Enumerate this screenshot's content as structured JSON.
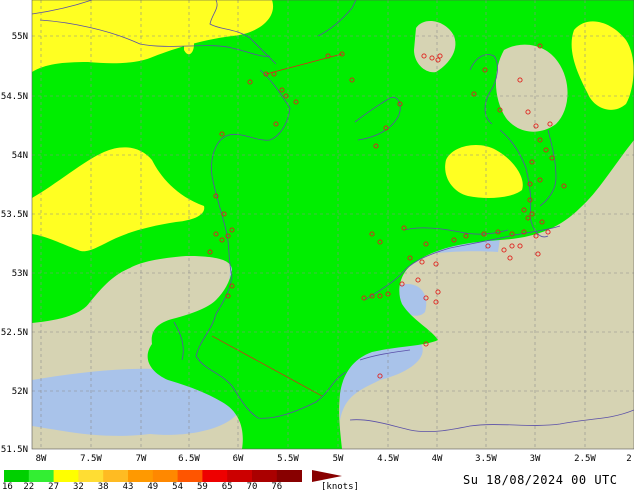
{
  "map": {
    "lat_labels": [
      "55N",
      "54.5N",
      "54N",
      "53.5N",
      "53N",
      "52.5N",
      "52N",
      "51.5N"
    ],
    "lon_labels": [
      "8W",
      "7.5W",
      "7W",
      "6.5W",
      "6W",
      "5.5W",
      "5W",
      "4.5W",
      "4W",
      "3.5W",
      "3W",
      "2.5W",
      "2"
    ],
    "timestamp": "Su 18/08/2024 00 UTC"
  },
  "legend": {
    "labels": [
      "16",
      "22",
      "27",
      "32",
      "38",
      "43",
      "49",
      "54",
      "59",
      "65",
      "70",
      "76"
    ],
    "unit": "[knots]",
    "colors": [
      "#00d000",
      "#33ee33",
      "#ffff00",
      "#ffdd33",
      "#ffbb22",
      "#ff9900",
      "#ff8800",
      "#ff5500",
      "#ee0000",
      "#cc0000",
      "#aa0000",
      "#880000"
    ]
  },
  "colors": {
    "land": "#d6d3b3",
    "sea": "#a9c3ea",
    "green": "#00ee00",
    "yellow": "#ffff22",
    "stations": "#e0201c"
  }
}
